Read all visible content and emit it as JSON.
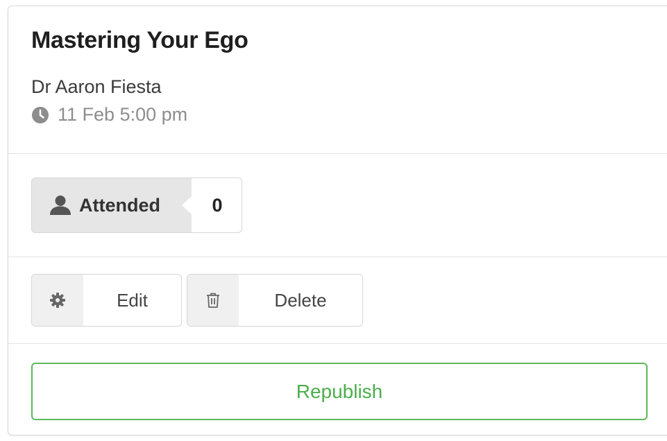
{
  "event": {
    "title": "Mastering Your Ego",
    "host": "Dr Aaron Fiesta",
    "datetime": "11 Feb 5:00 pm"
  },
  "attendance": {
    "label": "Attended",
    "count": "0",
    "icon": "user-icon"
  },
  "actions": {
    "edit_label": "Edit",
    "edit_icon": "gear-icon",
    "delete_label": "Delete",
    "delete_icon": "trash-icon",
    "republish_label": "Republish"
  },
  "colors": {
    "accent_green": "#5cb85c",
    "muted_text": "#8d8d8d",
    "badge_bg": "#e6e6e6"
  }
}
